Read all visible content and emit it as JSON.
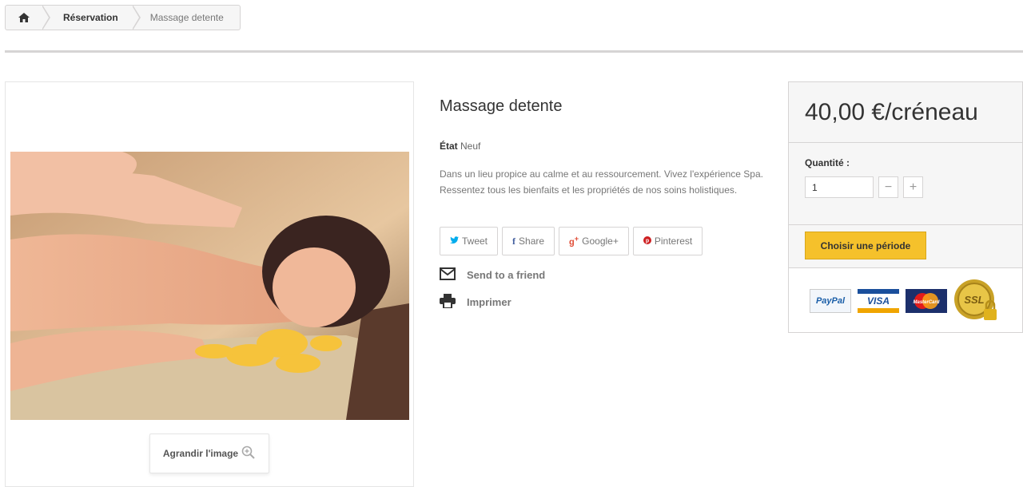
{
  "breadcrumb": {
    "home_icon": "home-icon",
    "link": "Réservation",
    "current": "Massage detente"
  },
  "image": {
    "zoom_label": "Agrandir l'image",
    "zoom_icon": "zoom-in-icon"
  },
  "product": {
    "title": "Massage detente",
    "condition_label": "État",
    "condition_value": "Neuf",
    "description": "Dans un lieu propice au calme et au ressourcement. Vivez l'expérience Spa. Ressentez tous les bienfaits et les propriétés de nos soins holistiques."
  },
  "social": [
    {
      "label": "Tweet",
      "icon": "twitter-icon",
      "color": "#00aced"
    },
    {
      "label": "Share",
      "icon": "facebook-icon",
      "color": "#435f9f"
    },
    {
      "label": "Google+",
      "icon": "google-plus-icon",
      "color": "#e04b34"
    },
    {
      "label": "Pinterest",
      "icon": "pinterest-icon",
      "color": "#ce1f21"
    }
  ],
  "actions": {
    "send_friend": "Send to a friend",
    "print": "Imprimer"
  },
  "buy": {
    "price": "40,00 €/créneau",
    "quantity_label": "Quantité :",
    "quantity_value": "1",
    "minus": "−",
    "plus": "+",
    "cart_label": "Choisir une période",
    "accent": "#f5c12b"
  },
  "payments": [
    {
      "label": "PayPal",
      "icon": "paypal-logo"
    },
    {
      "label": "VISA",
      "icon": "visa-logo"
    },
    {
      "label": "MasterCard",
      "icon": "mastercard-logo"
    },
    {
      "label": "SSL",
      "icon": "ssl-seal-icon"
    }
  ]
}
